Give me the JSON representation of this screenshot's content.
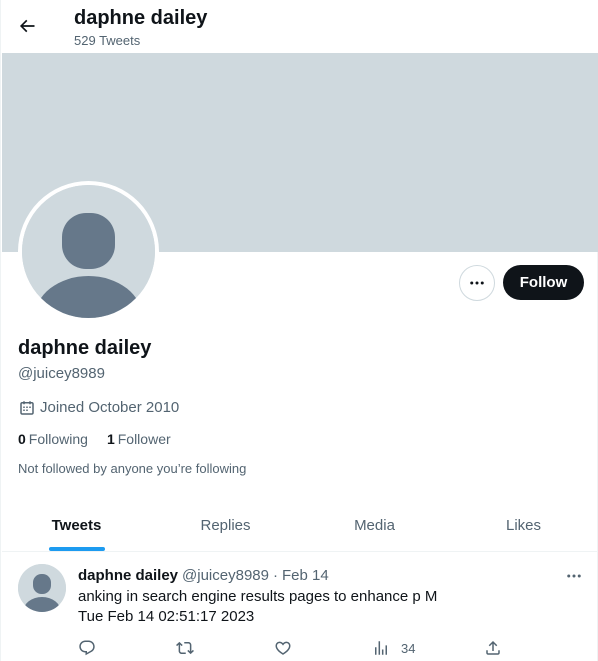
{
  "header": {
    "title": "daphne dailey",
    "tweet_count": "529 Tweets"
  },
  "profile": {
    "name": "daphne dailey",
    "handle": "@juicey8989",
    "joined": "Joined October 2010",
    "following_count": "0",
    "following_label": "Following",
    "followers_count": "1",
    "followers_label": "Follower",
    "not_followed_text": "Not followed by anyone you’re following",
    "follow_button": "Follow"
  },
  "tabs": [
    {
      "label": "Tweets",
      "active": true
    },
    {
      "label": "Replies",
      "active": false
    },
    {
      "label": "Media",
      "active": false
    },
    {
      "label": "Likes",
      "active": false
    }
  ],
  "tweet": {
    "name": "daphne dailey",
    "handle": "@juicey8989",
    "separator": "·",
    "date": "Feb 14",
    "line1": "anking in search engine results pages to enhance p M",
    "line2": "Tue Feb 14 02:51:17 2023",
    "views": "34"
  },
  "icons": {
    "back": "arrow-left-icon",
    "more": "more-horizontal-icon",
    "calendar": "calendar-icon",
    "reply": "reply-icon",
    "retweet": "retweet-icon",
    "like": "heart-icon",
    "views": "analytics-icon",
    "share": "share-icon"
  },
  "colors": {
    "accent": "#1d9bf0",
    "banner": "#cfd9de",
    "text": "#0f1419",
    "muted": "#536471"
  }
}
